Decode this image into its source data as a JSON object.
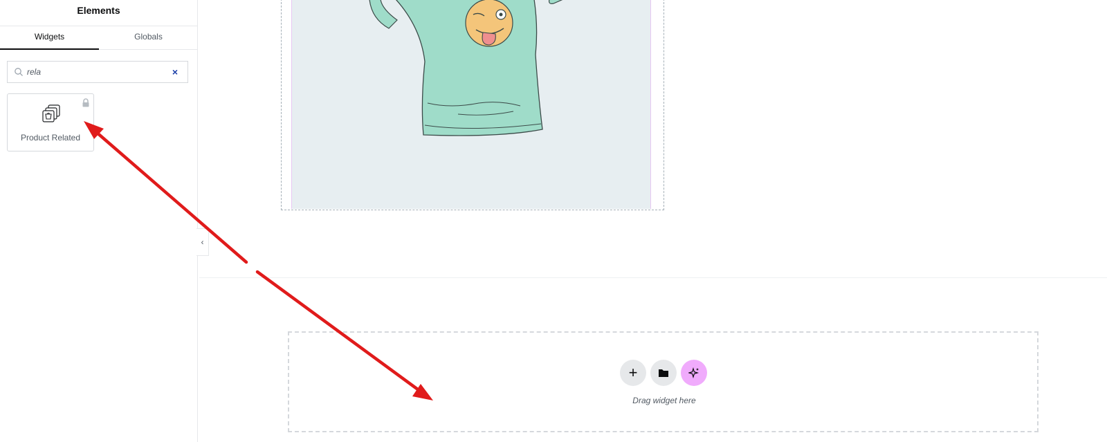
{
  "sidebar": {
    "title": "Elements",
    "tabs": [
      {
        "label": "Widgets",
        "active": true
      },
      {
        "label": "Globals",
        "active": false
      }
    ],
    "search": {
      "value": "rela",
      "clear_icon": "×"
    },
    "widgets": [
      {
        "label": "Product Related",
        "icon": "product-related-icon",
        "locked": true
      }
    ],
    "collapse_icon": "‹"
  },
  "canvas": {
    "drop_zone": {
      "add_icon": "+",
      "hint": "Drag widget here"
    }
  },
  "colors": {
    "accent_arrow": "#e01b1b",
    "ai_button": "#f0abfc",
    "tshirt": "#9fdcc9"
  }
}
